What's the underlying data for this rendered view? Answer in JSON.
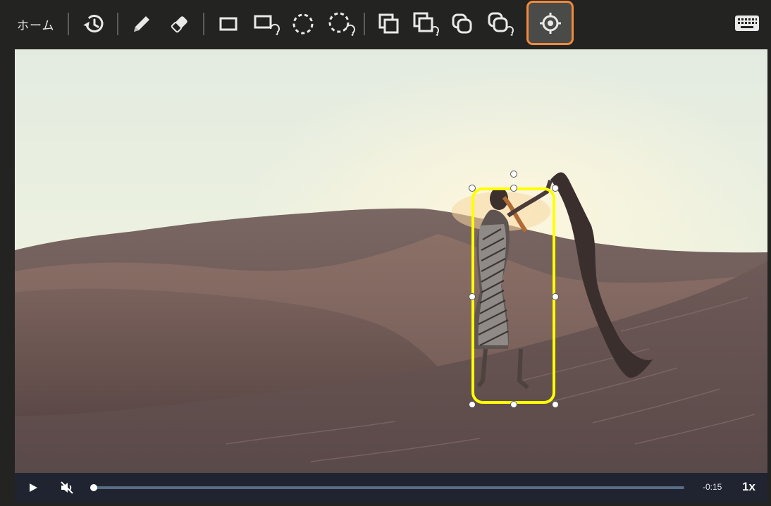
{
  "toolbar": {
    "home_label": "ホーム",
    "tools": [
      {
        "name": "history-icon"
      },
      {
        "name": "pencil-icon"
      },
      {
        "name": "eraser-icon"
      },
      {
        "name": "rectangle-icon"
      },
      {
        "name": "rectangle-rotate-icon"
      },
      {
        "name": "dashed-circle-icon"
      },
      {
        "name": "dashed-circle-rotate-icon"
      },
      {
        "name": "stacked-squares-icon"
      },
      {
        "name": "stacked-squares-rotate-icon"
      },
      {
        "name": "stacked-rounded-icon"
      },
      {
        "name": "stacked-rounded-rotate-icon"
      },
      {
        "name": "target-icon",
        "active": true
      }
    ],
    "keyboard_icon": "keyboard-icon",
    "active_outline_color": "#f08a3c"
  },
  "annotation": {
    "shape": "rounded-rectangle",
    "color": "#ffff00"
  },
  "player": {
    "time_remaining": "-0:15",
    "speed": "1x",
    "progress": 0.0,
    "muted": true
  }
}
